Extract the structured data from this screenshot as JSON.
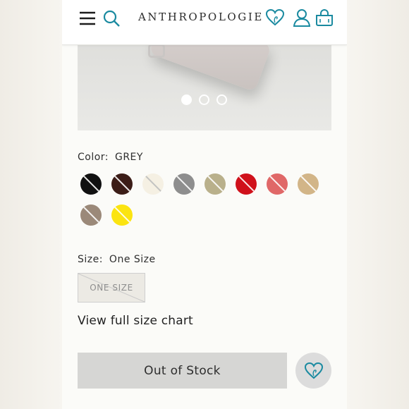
{
  "header": {
    "logo": "ANTHROPOLOGIE",
    "icons": [
      "menu-icon",
      "search-icon",
      "heart-icon",
      "account-icon",
      "basket-icon"
    ],
    "icon_color": "#1a8aa0"
  },
  "gallery": {
    "dots": [
      true,
      false,
      false
    ]
  },
  "color": {
    "label": "Color:",
    "selected": "GREY",
    "swatches": [
      {
        "name": "black",
        "hex": "#111111"
      },
      {
        "name": "brown",
        "hex": "#3c1d17"
      },
      {
        "name": "ivory",
        "hex": "#f5f0e3"
      },
      {
        "name": "grey",
        "hex": "#8e8e8e"
      },
      {
        "name": "sage",
        "hex": "#b9b08b"
      },
      {
        "name": "red",
        "hex": "#d0111b"
      },
      {
        "name": "coral",
        "hex": "#e06868"
      },
      {
        "name": "tan",
        "hex": "#d2b588"
      },
      {
        "name": "taupe",
        "hex": "#9b8979"
      },
      {
        "name": "yellow",
        "hex": "#fbe411"
      }
    ]
  },
  "size": {
    "label": "Size:",
    "selected": "One Size",
    "options": [
      "ONE SIZE"
    ]
  },
  "links": {
    "size_chart": "View full size chart"
  },
  "actions": {
    "out_of_stock": "Out of Stock",
    "wishlist_icon": "heart-icon"
  }
}
